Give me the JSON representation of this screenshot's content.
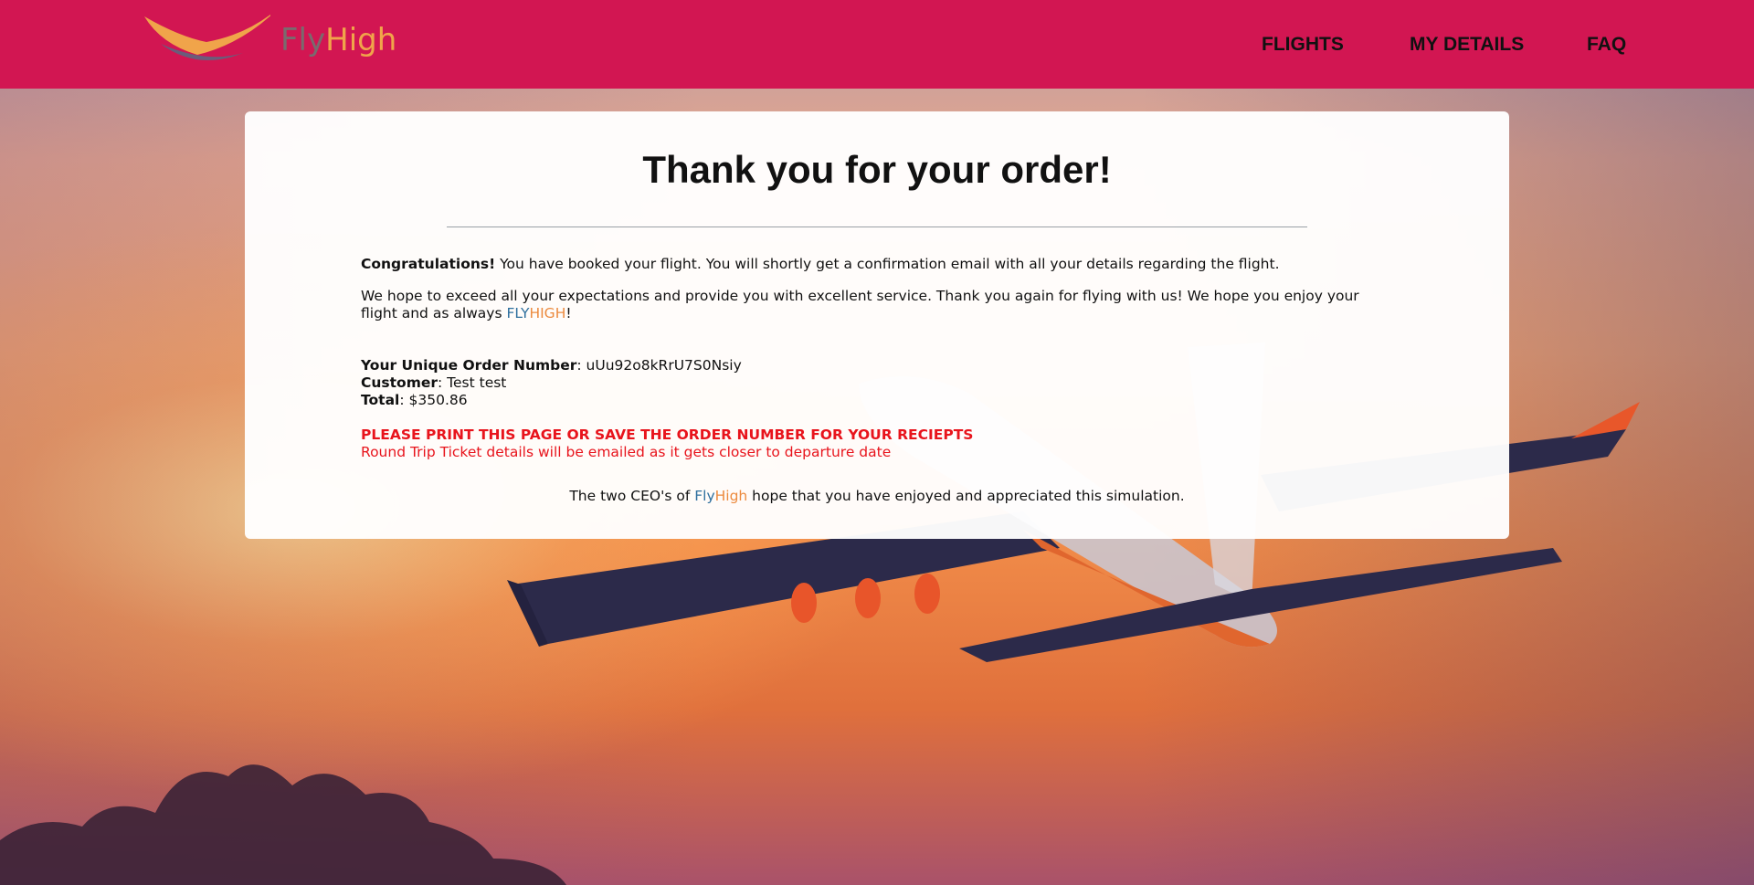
{
  "header": {
    "logo_text_fly": "Fly",
    "logo_text_high": "High",
    "nav": [
      "FLIGHTS",
      "MY DETAILS",
      "FAQ"
    ]
  },
  "card": {
    "title": "Thank you for your order!",
    "congrats_label": "Congratulations!",
    "congrats_text": " You have booked your flight. You will shortly get a confirmation email with all your details regarding the flight.",
    "hope_text": "We hope to exceed all your expectations and provide you with excellent service. Thank you again for flying with us! We hope you enjoy your flight and as always ",
    "brand_fly_upper": "FLY",
    "brand_high_upper": "HIGH",
    "exclaim": "!",
    "order_number_label": "Your Unique Order Number",
    "order_number": ": uUu92o8kRrU7S0Nsiy",
    "customer_label": "Customer",
    "customer": ": Test test",
    "total_label": "Total",
    "total": ": $350.86",
    "print_notice": "PLEASE PRINT THIS PAGE OR SAVE THE ORDER NUMBER FOR YOUR RECIEPTS",
    "round_trip_notice": "Round Trip Ticket details will be emailed as it gets closer to departure date",
    "footer_prefix": "The two CEO's of ",
    "footer_brand_fly": "Fly",
    "footer_brand_high": "High",
    "footer_suffix": " hope that you have enjoyed and appreciated this simulation."
  },
  "colors": {
    "header_bg": "#d21652",
    "brand_blue": "#2e6f9e",
    "brand_orange": "#ec8a3e",
    "notice_red": "#e8141c"
  }
}
